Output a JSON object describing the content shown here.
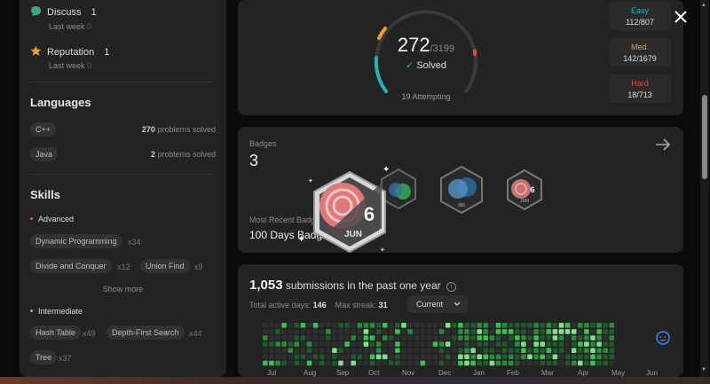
{
  "stats": {
    "discuss": {
      "label": "Discuss",
      "value": "1",
      "sub_label": "Last week",
      "sub_value": "0"
    },
    "reputation": {
      "label": "Reputation",
      "value": "1",
      "sub_label": "Last week",
      "sub_value": "0"
    }
  },
  "languages": {
    "heading": "Languages",
    "items": [
      {
        "name": "C++",
        "count": "270",
        "suffix": "problems solved"
      },
      {
        "name": "Java",
        "count": "2",
        "suffix": "problems solved"
      }
    ]
  },
  "skills": {
    "heading": "Skills",
    "advanced": {
      "label": "Advanced",
      "color": "#e05a5a",
      "items": [
        {
          "name": "Dynamic Programming",
          "count": "x34"
        },
        {
          "name": "Divide and Conquer",
          "count": "x12"
        },
        {
          "name": "Union Find",
          "count": "x9"
        }
      ],
      "show_more": "Show more"
    },
    "intermediate": {
      "label": "Intermediate",
      "color": "#f0a030",
      "items": [
        {
          "name": "Hash Table",
          "count": "x49"
        },
        {
          "name": "Depth-First Search",
          "count": "x44"
        },
        {
          "name": "Tree",
          "count": "x37"
        }
      ]
    }
  },
  "progress": {
    "solved": "272",
    "total": "/3199",
    "solved_label": "Solved",
    "attempting": "19 Attempting",
    "difficulty": [
      {
        "label": "Easy",
        "value": "112/807",
        "color": "#1eb6b0"
      },
      {
        "label": "Med.",
        "value": "142/1679",
        "color": "#f0a030"
      },
      {
        "label": "Hard",
        "value": "18/713",
        "color": "#e04a4a"
      }
    ]
  },
  "badges": {
    "label": "Badges",
    "count": "3",
    "recent_label": "Most Recent Badge",
    "recent_value": "100 Days Badge",
    "featured": {
      "line1": "6",
      "line2": "JUN"
    },
    "small_badges": [
      {
        "icon": "badge-green-icon"
      },
      {
        "icon": "badge-blue-icon",
        "text": "365"
      },
      {
        "icon": "badge-jun-icon",
        "line1": "6",
        "line2": "JUN"
      }
    ]
  },
  "submissions": {
    "count": "1,053",
    "text": "submissions in the past one year",
    "active_label": "Total active days:",
    "active_value": "146",
    "streak_label": "Max streak:",
    "streak_value": "31",
    "dropdown": "Current",
    "months": [
      "Jul",
      "Aug",
      "Sep",
      "Oct",
      "Nov",
      "Dec",
      "Jan",
      "Feb",
      "Mar",
      "Apr",
      "May",
      "Jun"
    ]
  },
  "colors": {
    "accent_green": "#39c04f",
    "hard_red": "#e04a4a"
  }
}
